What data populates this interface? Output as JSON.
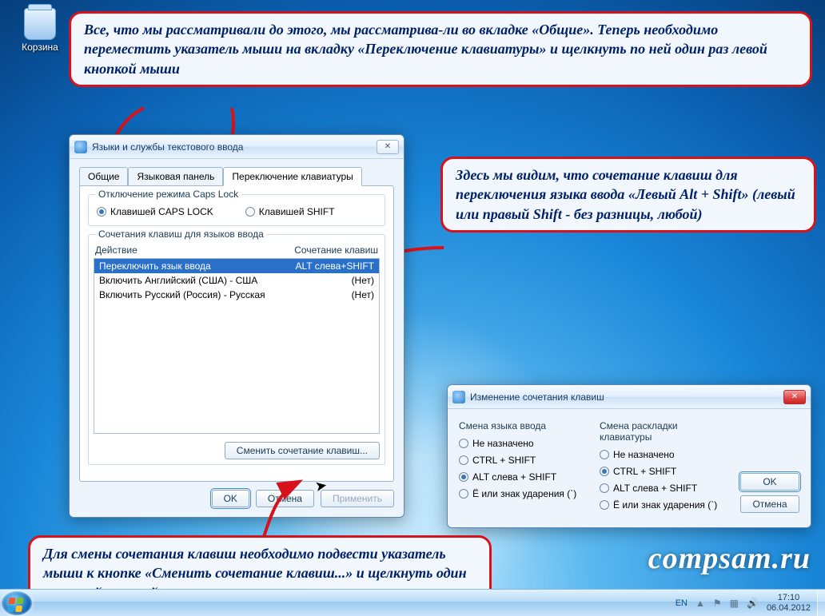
{
  "desktop": {
    "recycle_bin_label": "Корзина"
  },
  "callouts": {
    "top": " Все, что мы рассматривали до этого, мы рассматрива-ли во вкладке «Общие». Теперь необходимо переместить указатель мыши на вкладку «Переключение клавиатуры» и щелкнуть по ней один раз левой кнопкой мыши",
    "right": " Здесь мы видим, что сочетание клавиш для переключения языка ввода «Левый Alt + Shift» (левый или правый Shift - без разницы, любой)",
    "bottom": " Для смены сочетания клавиш необходимо подвести указатель мыши к кнопке «Сменить сочетание клавиш...» и щелкнуть один раз левой кнопкой мыши"
  },
  "dlg1": {
    "title": "Языки и службы текстового ввода",
    "tabs": {
      "general": "Общие",
      "langbar": "Языковая панель",
      "switch": "Переключение клавиатуры"
    },
    "caps_group": "Отключение режима Caps Lock",
    "caps_caps": "Клавишей CAPS LOCK",
    "caps_shift": "Клавишей SHIFT",
    "hotkeys_group": "Сочетания клавиш для языков ввода",
    "col_action": "Действие",
    "col_combo": "Сочетание клавиш",
    "rows": [
      {
        "action": "Переключить язык ввода",
        "combo": "ALT слева+SHIFT"
      },
      {
        "action": "Включить Английский (США) - США",
        "combo": "(Нет)"
      },
      {
        "action": "Включить Русский (Россия) - Русская",
        "combo": "(Нет)"
      }
    ],
    "change_btn": "Сменить сочетание клавиш...",
    "ok": "OK",
    "cancel": "Отмена",
    "apply": "Применить"
  },
  "dlg2": {
    "title": "Изменение сочетания клавиш",
    "col1_header": "Смена языка ввода",
    "col2_header": "Смена раскладки клавиатуры",
    "options": {
      "none": "Не назначено",
      "ctrl_shift": "CTRL + SHIFT",
      "alt_left_shift": "ALT слева + SHIFT",
      "e_accent": "Ё или знак ударения (`)"
    },
    "col1_selected": "alt_left_shift",
    "col2_selected": "ctrl_shift",
    "ok": "OK",
    "cancel": "Отмена"
  },
  "taskbar": {
    "lang": "EN",
    "time": "17:10",
    "date": "06.04.2012"
  },
  "watermark": "compsam.ru"
}
